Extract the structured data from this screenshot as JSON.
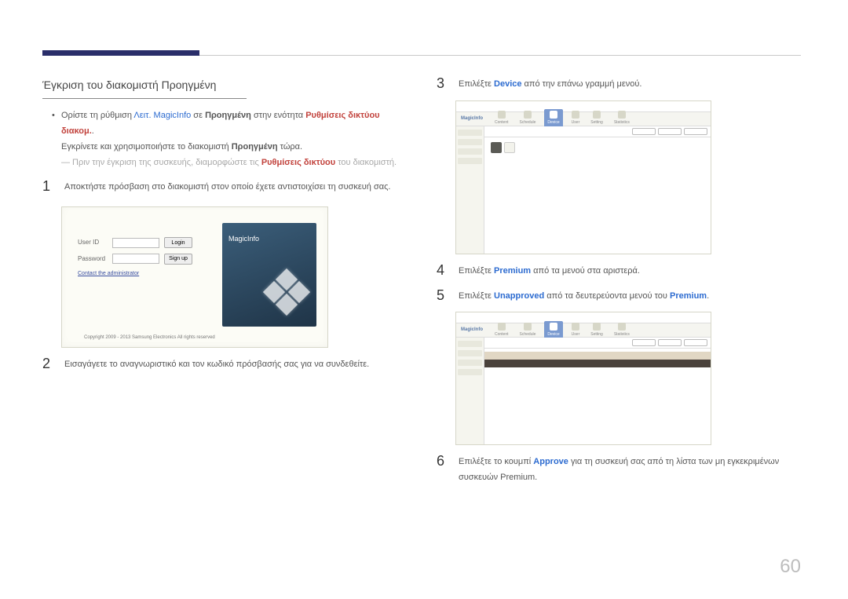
{
  "left": {
    "heading": "Έγκριση του διακομιστή Προηγμένη",
    "bullet_pre": "Ορίστε τη ρύθμιση ",
    "bullet_blue1": "Λειτ. MagicInfo",
    "bullet_mid1": " σε ",
    "bullet_bold1": "Προηγμένη",
    "bullet_mid2": " στην ενότητα ",
    "bullet_red1": "Ρυθμίσεις δικτύου διακομ.",
    "bullet_post": ".",
    "indent_pre": "Εγκρίνετε και χρησιμοποιήστε το διακομιστή ",
    "indent_bold": "Προηγμένη",
    "indent_post": " τώρα.",
    "dash_pre": "― Πριν την έγκριση της συσκευής, διαμορφώστε τις ",
    "dash_red": "Ρυθμίσεις δικτύου",
    "dash_post": " του διακομιστή.",
    "step1_num": "1",
    "step1_text": "Αποκτήστε πρόσβαση στο διακομιστή στον οποίο έχετε αντιστοιχίσει τη συσκευή σας.",
    "step2_num": "2",
    "step2_text": "Εισαγάγετε το αναγνωριστικό και τον κωδικό πρόσβασής σας για να συνδεθείτε.",
    "login": {
      "userid_label": "User ID",
      "password_label": "Password",
      "login_btn": "Login",
      "signup_btn": "Sign up",
      "contact_link": "Contact the administrator",
      "brand": "MagicInfo",
      "copyright": "Copyright 2009 - 2013 Samsung Electronics All rights reserved"
    }
  },
  "right": {
    "step3_num": "3",
    "step3_pre": "Επιλέξτε ",
    "step3_blue": "Device",
    "step3_post": " από την επάνω γραμμή μενού.",
    "step4_num": "4",
    "step4_pre": "Επιλέξτε ",
    "step4_blue": "Premium",
    "step4_post": " από τα μενού στα αριστερά.",
    "step5_num": "5",
    "step5_pre": "Επιλέξτε ",
    "step5_blue1": "Unapproved",
    "step5_mid": " από τα δευτερεύοντα μενού του ",
    "step5_blue2": "Premium",
    "step5_post": ".",
    "step6_num": "6",
    "step6_pre": "Επιλέξτε το κουμπί ",
    "step6_blue": "Approve",
    "step6_post": " για τη συσκευή σας από τη λίστα των μη εγκεκριμένων συσκευών Premium.",
    "menu": {
      "brand": "MagicInfo",
      "m1": "Content",
      "m2": "Schedule",
      "m3": "Device",
      "m4": "User",
      "m5": "Setting",
      "m6": "Statistics"
    }
  },
  "page_number": "60"
}
